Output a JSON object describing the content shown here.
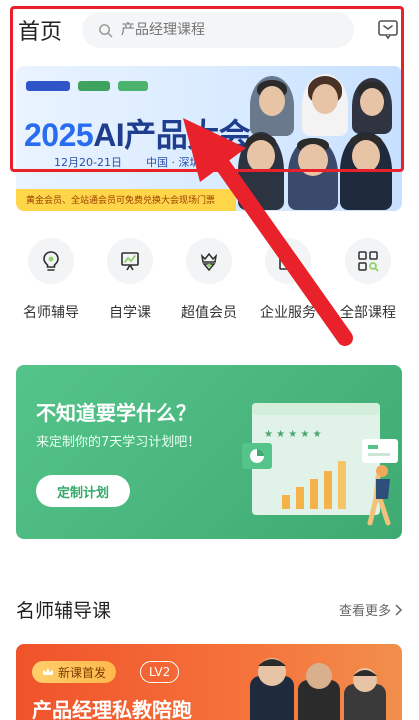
{
  "header": {
    "title": "首页",
    "search_placeholder": "产品经理课程",
    "message_icon": "message-icon"
  },
  "banner": {
    "headline_year": "2025",
    "headline_text": "AI产品大会",
    "date": "12月20-21日",
    "place": "中国 · 深圳",
    "strip_text": "黄金会员、全站通会员可免费兑换大会现场门票"
  },
  "quick_entries": [
    {
      "label": "名师辅导",
      "icon": "bulb-icon"
    },
    {
      "label": "自学课",
      "icon": "easel-icon"
    },
    {
      "label": "超值会员",
      "icon": "crown-badge-icon"
    },
    {
      "label": "企业服务",
      "icon": "enterprise-icon"
    },
    {
      "label": "全部课程",
      "icon": "grid-search-icon"
    }
  ],
  "promo": {
    "title": "不知道要学什么？",
    "subtitle": "来定制你的7天学习计划吧！",
    "button": "定制计划"
  },
  "section": {
    "title": "名师辅导课",
    "more": "查看更多"
  },
  "course": {
    "tag": "新课首发",
    "level": "LV2",
    "title": "产品经理私教陪跑"
  },
  "colors": {
    "highlight": "#e8212a",
    "green": "#3eaa72",
    "orange": "#f0522a"
  }
}
